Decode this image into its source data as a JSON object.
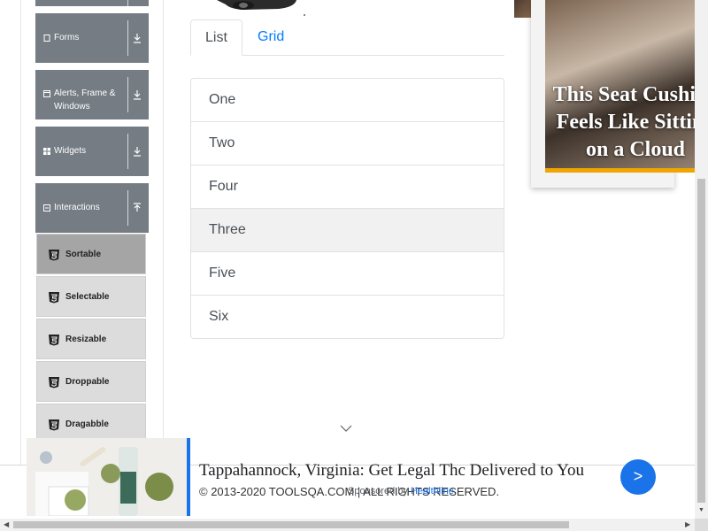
{
  "sidebar": {
    "groups": [
      {
        "label": "Forms",
        "icon": "form-icon",
        "toggle": "download-icon"
      },
      {
        "label": "Alerts, Frame & Windows",
        "icon": "window-icon",
        "toggle": "download-icon"
      },
      {
        "label": "Widgets",
        "icon": "widgets-icon",
        "toggle": "download-icon"
      },
      {
        "label": "Interactions",
        "icon": "interactions-icon",
        "toggle": "upload-icon"
      }
    ],
    "items": [
      {
        "label": "Sortable",
        "active": true
      },
      {
        "label": "Selectable"
      },
      {
        "label": "Resizable"
      },
      {
        "label": "Droppable"
      },
      {
        "label": "Dragabble"
      }
    ]
  },
  "main": {
    "tabs": [
      {
        "label": "List",
        "active": true
      },
      {
        "label": "Grid"
      }
    ],
    "list_items": [
      "One",
      "Two",
      "Four",
      "Three",
      "Five",
      "Six"
    ],
    "hovered_item": "Three"
  },
  "right_ad": {
    "headline": "This Seat Cushion Feels Like Sitting on a Cloud"
  },
  "bottom_ad": {
    "headline": "Tappahannock, Virginia: Get Legal Thc Delivered to You",
    "next_button": ">",
    "sponsored_prefix": "Sponsored by",
    "sponsored_brand": "Healthline"
  },
  "footer": {
    "copyright": "© 2013-2020 TOOLSQA.COM | ALL RIGHTS RESERVED."
  },
  "colors": {
    "sidebar_group": "#757c83",
    "tab_link": "#007bff",
    "ad_blue": "#1a73e8",
    "ad_accent": "#f0a500"
  }
}
